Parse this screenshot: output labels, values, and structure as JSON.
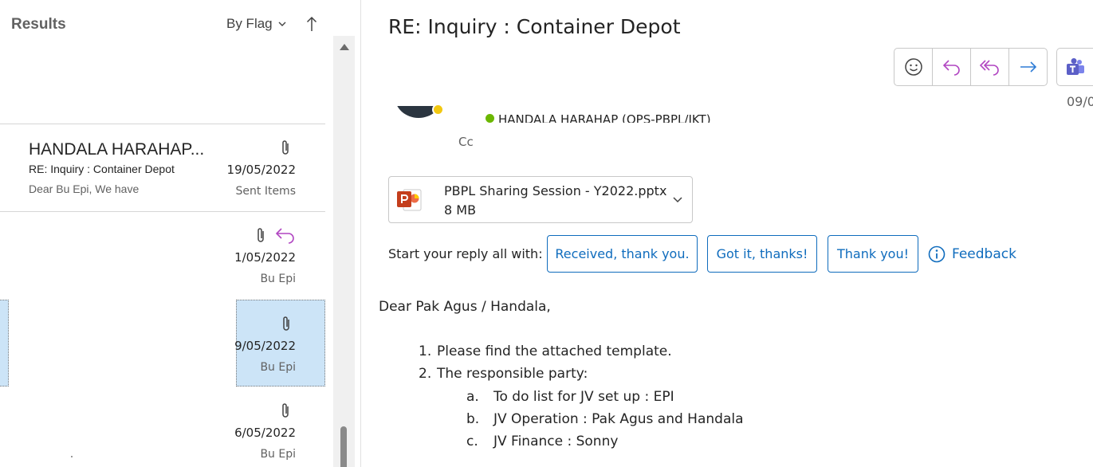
{
  "list": {
    "header": {
      "title": "Results",
      "sort_label": "By Flag"
    },
    "items": [
      {
        "sender": "HANDALA HARAHAP...",
        "subject": "RE: Inquiry : Container Depot",
        "preview": "Dear Bu Epi,  We have",
        "date": "19/05/2022",
        "folder": "Sent Items"
      },
      {
        "date": "1/05/2022",
        "folder": "Bu Epi"
      },
      {
        "date": "9/05/2022",
        "folder": "Bu Epi"
      },
      {
        "date": "6/05/2022",
        "folder": "Bu Epi"
      }
    ]
  },
  "message": {
    "subject": "RE: Inquiry : Container Depot",
    "date": "09/0",
    "to_name": "HANDALA HARAHAP (OPS-PBPL/JKT)",
    "cc_label": "Cc",
    "attachment": {
      "name": "PBPL Sharing Session - Y2022.pptx",
      "size": "8 MB"
    },
    "reply_prompt": "Start your reply all with:",
    "suggestions": [
      "Received, thank you.",
      "Got it, thanks!",
      "Thank you!"
    ],
    "feedback_label": "Feedback",
    "body": {
      "greeting": "Dear Pak Agus / Handala,",
      "items": [
        {
          "marker": "1.",
          "text": "Please find the attached template."
        },
        {
          "marker": "2.",
          "text": "The responsible party:"
        }
      ],
      "subitems": [
        {
          "marker": "a.",
          "text": "To do list for JV set up : EPI"
        },
        {
          "marker": "b.",
          "text": "JV Operation : Pak Agus and Handala"
        },
        {
          "marker": "c.",
          "text": "JV Finance : Sonny"
        }
      ]
    }
  },
  "colors": {
    "accent": "#0f6cbd",
    "reply_purple": "#b146c2",
    "forward_blue": "#2e7cd6",
    "selection": "#cce4f7",
    "presence_available": "#6bb700",
    "presence_away": "#f2c811",
    "powerpoint": "#c43e1c",
    "teams": "#5b5fc7"
  },
  "icons": {
    "sort": "chevron-down-icon",
    "sort_direction": "arrow-up-icon",
    "attachment": "paperclip-icon",
    "replied": "reply-icon",
    "emoji": "smiley-icon",
    "reply": "reply-icon",
    "reply_all": "reply-all-icon",
    "forward": "forward-icon",
    "teams": "teams-icon",
    "file": "powerpoint-icon",
    "feedback": "info-icon"
  }
}
